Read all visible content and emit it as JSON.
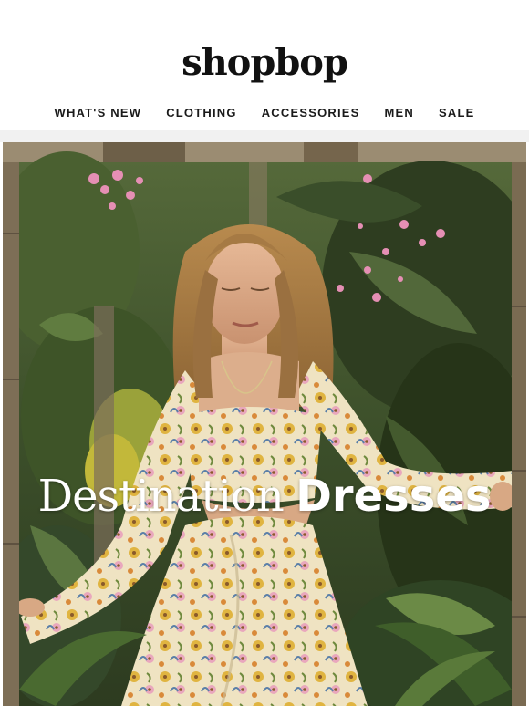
{
  "header": {
    "logo_text": "shopbop",
    "nav": [
      {
        "label": "WHAT'S NEW"
      },
      {
        "label": "CLOTHING"
      },
      {
        "label": "ACCESSORIES"
      },
      {
        "label": "MEN"
      },
      {
        "label": "SALE"
      }
    ]
  },
  "hero": {
    "headline_light": "Destination",
    "headline_bold": "Dresses",
    "image_subject": "model-in-floral-dress-jungle-photo"
  },
  "colors": {
    "page_background": "#ffffff",
    "divider_background": "#f1f1f1",
    "text_dark": "#111111",
    "headline_text": "#ffffff",
    "foliage_dark": "#2f3e22",
    "foliage_light": "#6f8a3e",
    "flower_pink": "#e58fb4",
    "dress_cream": "#efe3c2",
    "dress_yellow": "#e0b440"
  }
}
